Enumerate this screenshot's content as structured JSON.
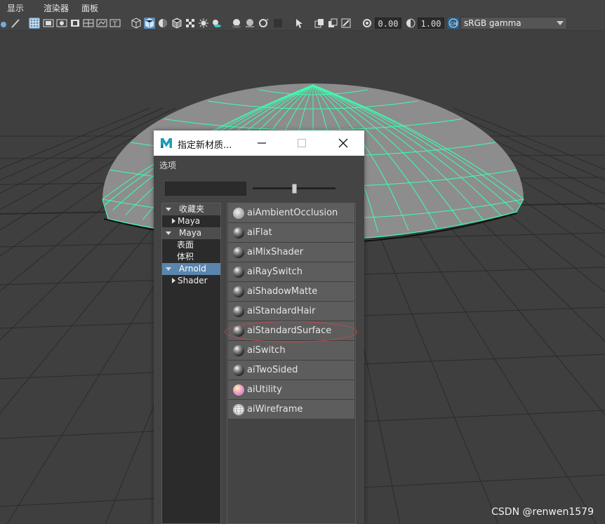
{
  "menubar": {
    "items": [
      "显示",
      "渲染器",
      "面板"
    ]
  },
  "toolbar": {
    "exposure": "0.00",
    "gamma": "1.00",
    "color_space": "sRGB gamma"
  },
  "dialog": {
    "title": "指定新材质...",
    "options_menu": "选项",
    "tree": {
      "favorites": "收藏夹",
      "favorites_maya": "Maya",
      "maya": "Maya",
      "maya_surface": "表面",
      "maya_volume": "体积",
      "arnold": "Arnold",
      "arnold_shader": "Shader"
    },
    "shaders": [
      {
        "label": "aiAmbientOcclusion",
        "swatch": "ao"
      },
      {
        "label": "aiFlat",
        "swatch": "ball"
      },
      {
        "label": "aiMixShader",
        "swatch": "ball"
      },
      {
        "label": "aiRaySwitch",
        "swatch": "ball"
      },
      {
        "label": "aiShadowMatte",
        "swatch": "ball"
      },
      {
        "label": "aiStandardHair",
        "swatch": "ball"
      },
      {
        "label": "aiStandardSurface",
        "swatch": "ball"
      },
      {
        "label": "aiSwitch",
        "swatch": "ball"
      },
      {
        "label": "aiTwoSided",
        "swatch": "ball"
      },
      {
        "label": "aiUtility",
        "swatch": "util"
      },
      {
        "label": "aiWireframe",
        "swatch": "wire"
      }
    ]
  },
  "watermark": "CSDN @renwen1579",
  "colors": {
    "wireframe": "#3dffb0",
    "selection": "#5a86ae",
    "highlight_ring": "#c8474a"
  }
}
